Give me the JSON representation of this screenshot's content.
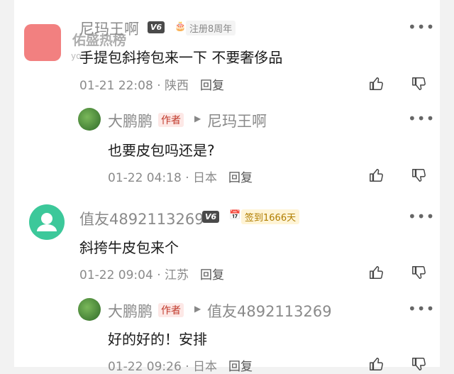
{
  "watermark": {
    "title": "佑盛热榜",
    "sub": "yo"
  },
  "comments": [
    {
      "user": "尼玛王啊",
      "level": "V6",
      "badge": "注册8周年",
      "text": "手提包斜挎包来一下 不要奢侈品",
      "time": "01-21 22:08",
      "location": "陕西",
      "reply_label": "回复",
      "more": "•••",
      "reply": {
        "user": "大鹏鹏",
        "author_tag": "作者",
        "reply_to": "尼玛王啊",
        "text": "也要皮包吗还是?",
        "time": "01-22 04:18",
        "location": "日本",
        "reply_label": "回复",
        "more": "•••"
      }
    },
    {
      "user": "值友4892113269",
      "level": "V6",
      "badge": "签到1666天",
      "text": "斜挎牛皮包来个",
      "time": "01-22 09:04",
      "location": "江苏",
      "reply_label": "回复",
      "more": "•••",
      "reply": {
        "user": "大鹏鹏",
        "author_tag": "作者",
        "reply_to": "值友4892113269",
        "text": "好的好的！安排",
        "time": "01-22 09:26",
        "location": "日本",
        "reply_label": "回复",
        "more": "•••"
      }
    }
  ],
  "colors": {
    "avatar_green": "#3cc89a",
    "author_red": "#c0392b",
    "badge_yellow": "#fff4d6"
  }
}
